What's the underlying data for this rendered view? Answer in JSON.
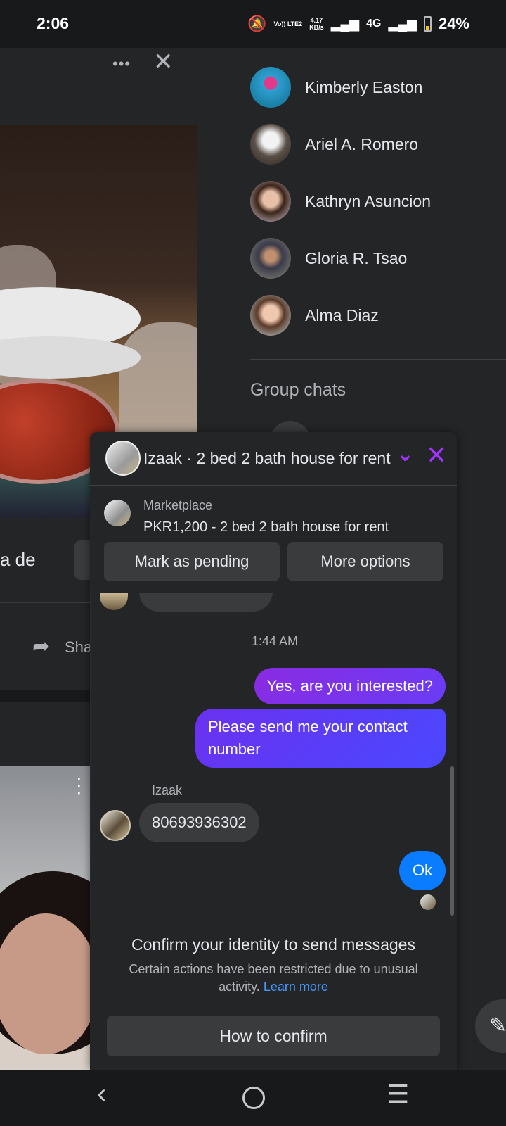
{
  "status_bar": {
    "time": "2:06",
    "volte": "Vo)) LTE2",
    "speed_value": "4.17",
    "speed_unit": "KB/s",
    "network": "4G",
    "battery": "24%"
  },
  "feed": {
    "caption_fragment": "a de",
    "share_label": "Sha"
  },
  "contacts": [
    {
      "name": "Kimberly Easton",
      "avatar_color": "#2f9fd1"
    },
    {
      "name": "Ariel A. Romero",
      "avatar_color": "#9a8f86"
    },
    {
      "name": "Kathryn Asuncion",
      "avatar_color": "#caa28c"
    },
    {
      "name": "Gloria R. Tsao",
      "avatar_color": "#6e7a6a"
    },
    {
      "name": "Alma Diaz",
      "avatar_color": "#b89a8a"
    }
  ],
  "group_chats_title": "Group chats",
  "chat": {
    "title": "Izaak · 2 bed 2 bath house for rent",
    "listing_source": "Marketplace",
    "listing_title": "PKR1,200 - 2 bed 2 bath house for rent",
    "buttons": {
      "pending": "Mark as pending",
      "more": "More options"
    },
    "timestamp": "1:44 AM",
    "messages": [
      {
        "from": "me",
        "text": "Yes, are you interested?"
      },
      {
        "from": "me",
        "text": "Please send me your contact number"
      },
      {
        "from": "Izaak",
        "text": "80693936302"
      },
      {
        "from": "me",
        "text": "Ok"
      }
    ],
    "sender_name": "Izaak",
    "accent_color": "#a033ff"
  },
  "confirm": {
    "title": "Confirm your identity to send messages",
    "body": "Certain actions have been restricted due to unusual activity.",
    "learn_more": "Learn more",
    "button": "How to confirm"
  }
}
